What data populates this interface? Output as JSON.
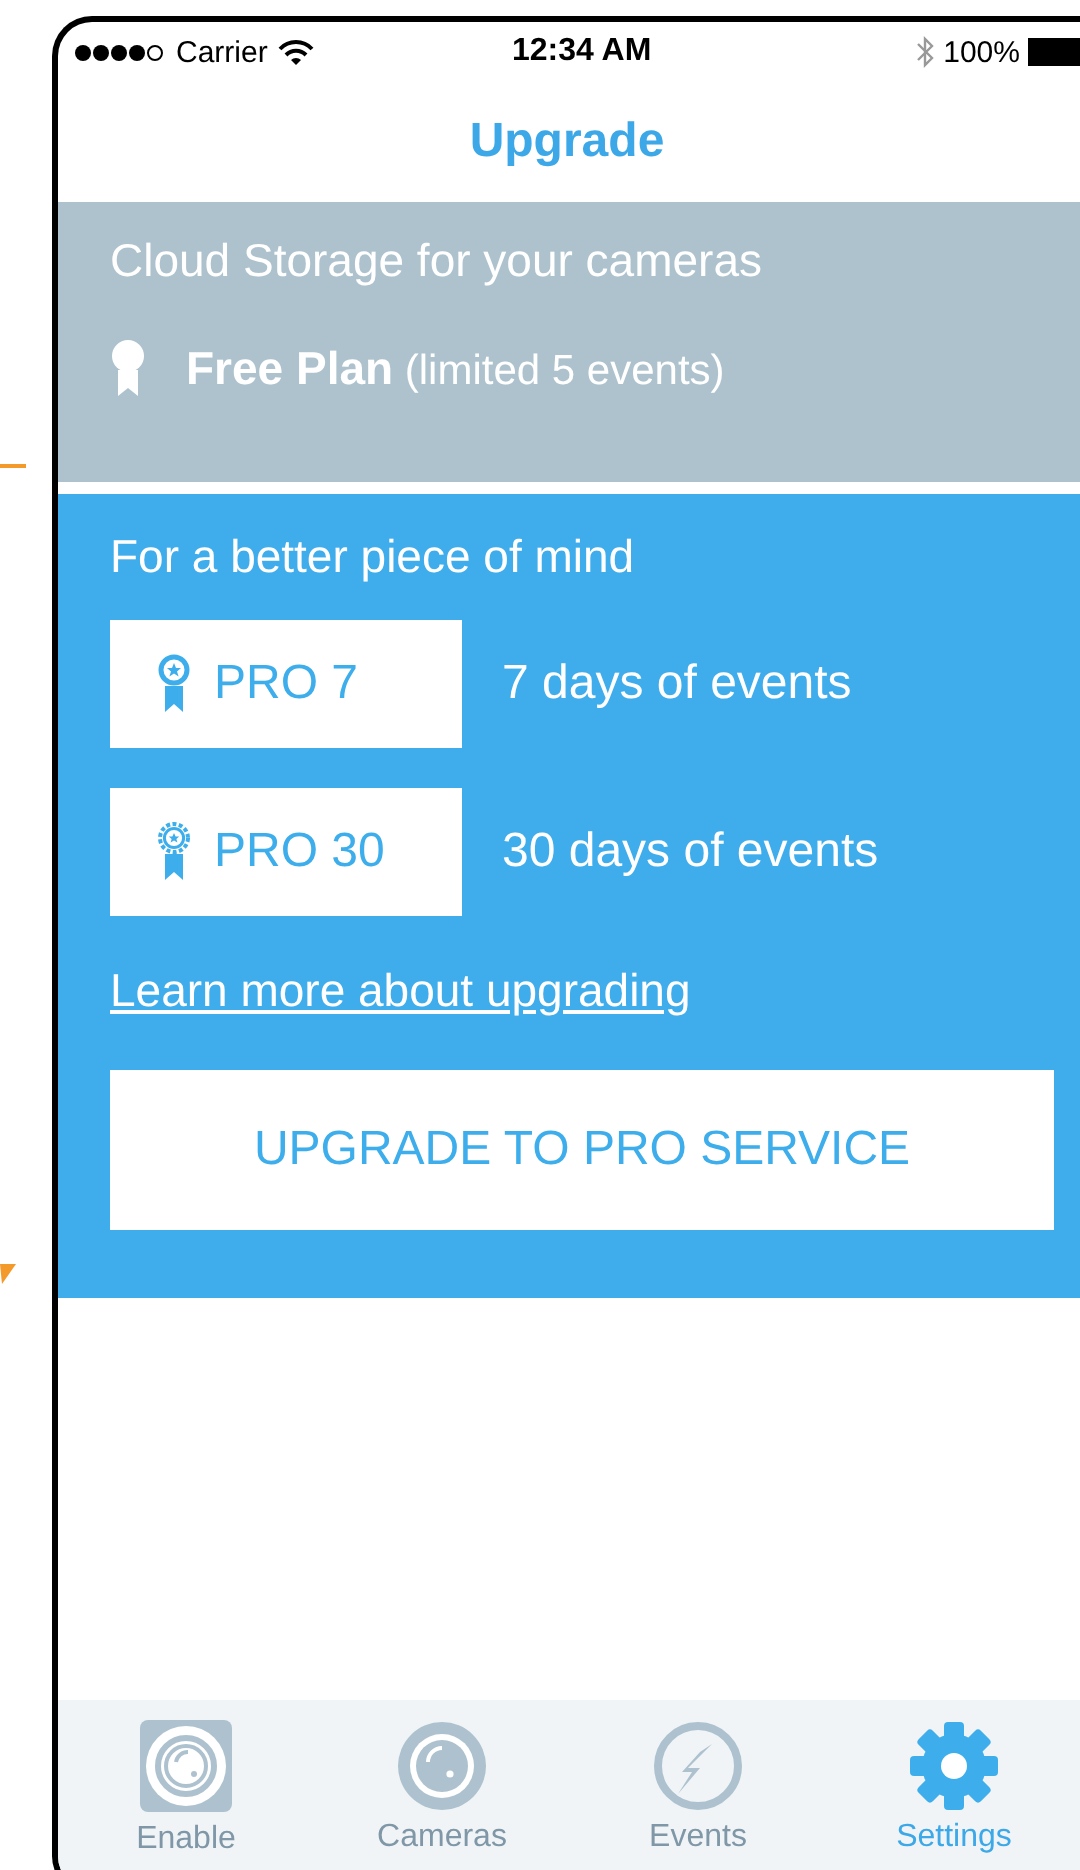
{
  "status_bar": {
    "carrier": "Carrier",
    "time": "12:34 AM",
    "battery": "100%"
  },
  "nav": {
    "title": "Upgrade"
  },
  "current_plan": {
    "heading": "Cloud Storage for your cameras",
    "plan": "**Free Plan** (limited 5 events)"
  },
  "upgrade": {
    "heading": "For a better piece of mind",
    "plans": [
      {
        "kind": "ribbon",
        "label": "PRO 7",
        "description": "7 days of events"
      },
      {
        "kind": "rosette",
        "label": "PRO 30",
        "description": "30 days of events"
      }
    ],
    "link": "Learn more about upgrading",
    "button": "UPGRADE TO PRO SERVICE"
  },
  "tabs": [
    {
      "kind": "enable",
      "label": "Enable",
      "selected": false
    },
    {
      "kind": "cameras",
      "label": "Cameras",
      "selected": false
    },
    {
      "kind": "events",
      "label": "Events",
      "selected": false
    },
    {
      "kind": "settings",
      "label": "Settings",
      "selected": true
    }
  ]
}
